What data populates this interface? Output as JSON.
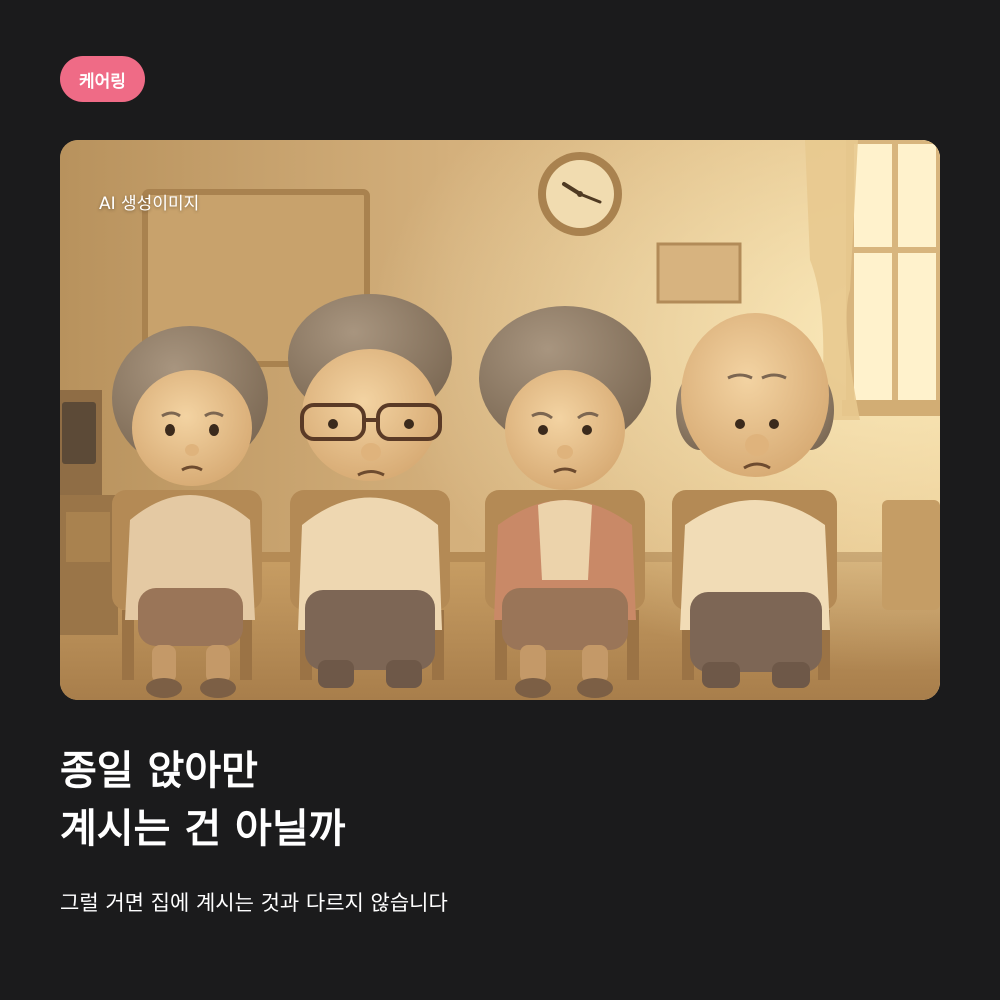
{
  "tag": {
    "label": "케어링",
    "color": "#ef6b86"
  },
  "image": {
    "overlay_label": "AI 생성이미지",
    "icons": [
      "wall-clock-icon",
      "window-icon",
      "television-icon"
    ],
    "figures": [
      "elderly-woman-figure",
      "elderly-man-glasses-figure",
      "elderly-woman-cardigan-figure",
      "bald-elderly-man-figure"
    ]
  },
  "headline": {
    "line1": "종일 앉아만",
    "line2": "계시는 건 아닐까"
  },
  "subtext": "그럴 거면 집에 계시는 것과 다르지 않습니다",
  "colors": {
    "background": "#1b1b1c",
    "text": "#ffffff",
    "accent": "#ef6b86"
  }
}
